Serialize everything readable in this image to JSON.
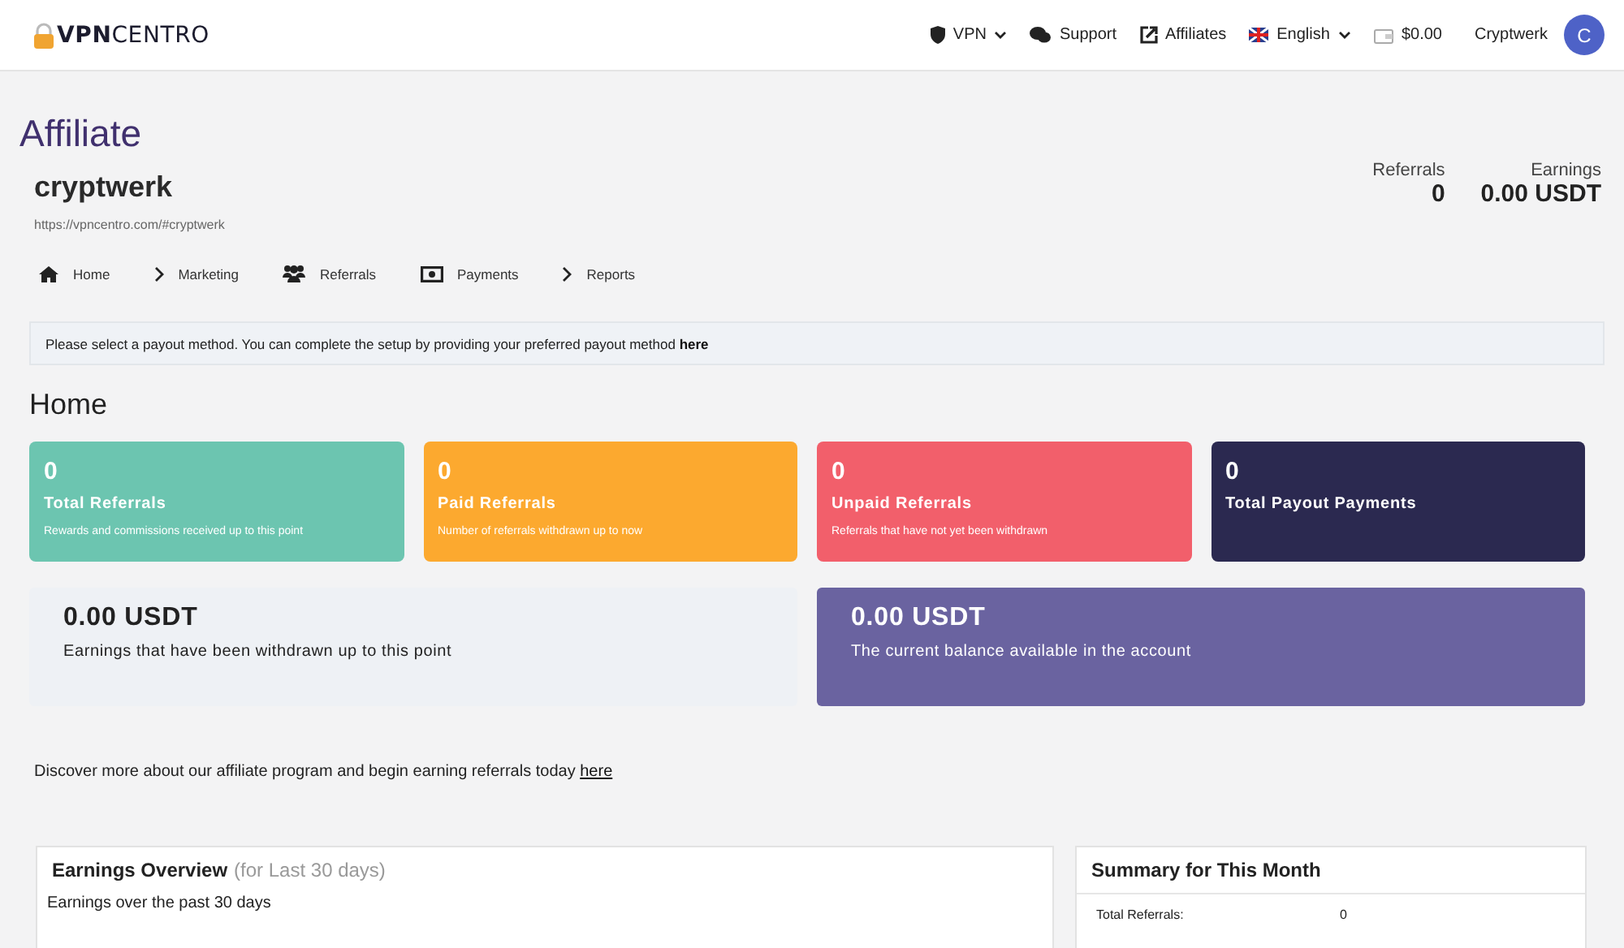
{
  "header": {
    "logo_bold": "VPN",
    "logo_light": "CENTRO",
    "nav": [
      {
        "label": "VPN",
        "dropdown": true
      },
      {
        "label": "Support",
        "dropdown": false
      },
      {
        "label": "Affiliates",
        "dropdown": false
      },
      {
        "label": "English",
        "dropdown": true
      },
      {
        "label": "$0.00",
        "dropdown": false
      }
    ],
    "user": "Cryptwerk",
    "avatar": "C"
  },
  "page_title": "Affiliate",
  "profile": {
    "name": "cryptwerk",
    "url": "https://vpncentro.com/#cryptwerk",
    "stats": [
      {
        "label": "Referrals",
        "value": "0"
      },
      {
        "label": "Earnings",
        "value": "0.00 USDT"
      }
    ]
  },
  "tabs": [
    {
      "label": "Home"
    },
    {
      "label": "Marketing"
    },
    {
      "label": "Referrals"
    },
    {
      "label": "Payments"
    },
    {
      "label": "Reports"
    }
  ],
  "notice": {
    "text": "Please select a payout method. You can complete the setup by providing your preferred payout method",
    "link": "here"
  },
  "section_title": "Home",
  "stat_cards": [
    {
      "value": "0",
      "title": "Total Referrals",
      "note": "Rewards and commissions received up to this point",
      "color": "#6cc5b0"
    },
    {
      "value": "0",
      "title": "Paid Referrals",
      "note": "Number of referrals withdrawn up to now",
      "color": "#fca92f"
    },
    {
      "value": "0",
      "title": "Unpaid Referrals",
      "note": "Referrals that have not yet been withdrawn",
      "color": "#f25f6b"
    },
    {
      "value": "0",
      "title": "Total Payout Payments",
      "color": "#2b2950"
    }
  ],
  "balance_cards": [
    {
      "value": "0.00 USDT",
      "note": "Earnings that have been withdrawn up to this point",
      "color": "#eef1f5",
      "dark": false
    },
    {
      "value": "0.00 USDT",
      "note": "The current balance available in the account",
      "color": "#6a63a0",
      "dark": true
    }
  ],
  "discover": {
    "text": "Discover more about our affiliate program and begin earning referrals today",
    "link": "here"
  },
  "overview": {
    "title": "Earnings Overview",
    "subtitle": "(for Last 30 days)",
    "caption": "Earnings over the past 30 days"
  },
  "summary": {
    "title": "Summary for This Month",
    "rows": [
      {
        "label": "Total Referrals:",
        "value": "0"
      }
    ]
  }
}
